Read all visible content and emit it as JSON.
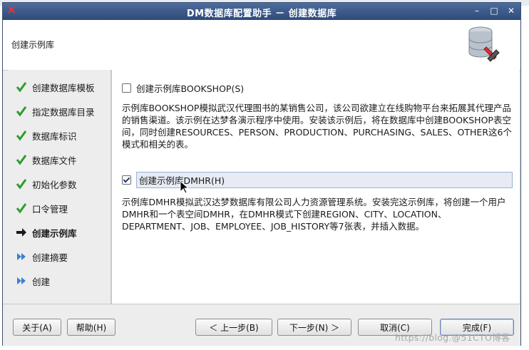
{
  "window": {
    "title": "DM数据库配置助手 － 创建数据库",
    "controls": [
      "–",
      "□",
      "✕"
    ]
  },
  "header": {
    "title": "创建示例库"
  },
  "steps": [
    {
      "label": "创建数据库模板",
      "status": "done"
    },
    {
      "label": "指定数据库目录",
      "status": "done"
    },
    {
      "label": "数据库标识",
      "status": "done"
    },
    {
      "label": "数据库文件",
      "status": "done"
    },
    {
      "label": "初始化参数",
      "status": "done"
    },
    {
      "label": "口令管理",
      "status": "done"
    },
    {
      "label": "创建示例库",
      "status": "current"
    },
    {
      "label": "创建摘要",
      "status": "pending"
    },
    {
      "label": "创建",
      "status": "pending"
    }
  ],
  "content": {
    "bookshop": {
      "label": "创建示例库BOOKSHOP(S)",
      "checked": false,
      "description": "示例库BOOKSHOP模拟武汉代理图书的某销售公司，该公司欲建立在线购物平台来拓展其代理产品的销售渠道。该示例在达梦各演示程序中使用。安装该示例后，将在数据库中创建BOOKSHOP表空间，同时创建RESOURCES、PERSON、PRODUCTION、PURCHASING、SALES、OTHER这6个模式和相关的表。"
    },
    "dmhr": {
      "label": "创建示例库DMHR(H)",
      "checked": true,
      "description": "示例库DMHR模拟武汉达梦数据库有限公司人力资源管理系统。安装完这示例库，将创建一个用户DMHR和一个表空间DMHR，在DMHR模式下创建REGION、CITY、LOCATION、DEPARTMENT、JOB、EMPLOYEE、JOB_HISTORY等7张表，并插入数据。"
    }
  },
  "buttons": {
    "about": "关于(A)",
    "help": "帮助(H)",
    "back": "＜ 上一步(B)",
    "next": "下一步(N) ＞",
    "cancel": "取消(C)",
    "finish": "完成(F)"
  },
  "watermark": "https://blog.@51CTO博客",
  "colors": {
    "titlebar": "#3a5a8a",
    "done_check": "#2e9b2e",
    "current_arrow": "#1a1a1a",
    "pending_arrow": "#3b7fd0"
  }
}
